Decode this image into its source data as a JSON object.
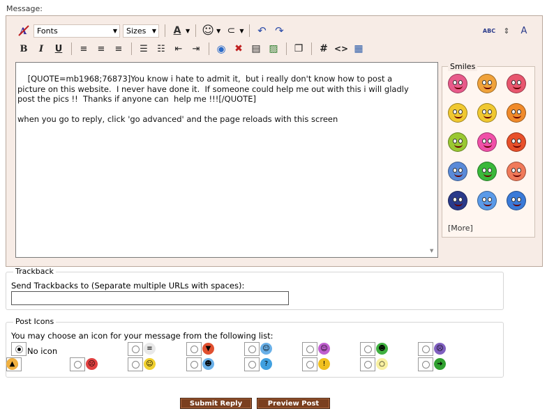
{
  "message_label": "Message:",
  "toolbar": {
    "fonts_label": "Fonts",
    "sizes_label": "Sizes",
    "font_color_glyph": "A",
    "bold": "B",
    "italic": "I",
    "underline": "U",
    "hash": "#",
    "code": "<>",
    "spell": "ABC",
    "text_size_label": "A"
  },
  "editor": {
    "text": "[QUOTE=mb1968;76873]You know i hate to admit it,  but i really don't know how to post a\npicture on this website.  I never have done it.  If someone could help me out with this i will gladly\npost the pics !!  Thanks if anyone can  help me !!![/QUOTE]\n\nwhen you go to reply, click 'go advanced' and the page reloads with this screen"
  },
  "smiles": {
    "title": "Smiles",
    "more_label": "[More]",
    "colors": [
      "#e85a8a",
      "#f0a23a",
      "#e8566e",
      "#f0c830",
      "#f0c830",
      "#f08a2a",
      "#9ac832",
      "#f050a8",
      "#e8502a",
      "#5a8ad8",
      "#3ab83a",
      "#f07a5a",
      "#2a3a8a",
      "#5a9ae8",
      "#3a7ad8"
    ]
  },
  "trackback": {
    "legend": "Trackback",
    "prompt": "Send Trackbacks to (Separate multiple URLs with spaces):",
    "value": ""
  },
  "post_icons": {
    "legend": "Post Icons",
    "prompt": "You may choose an icon for your message from the following list:",
    "no_icon_label": "No icon",
    "icons": [
      {
        "name": "document-icon",
        "color": "#e8e8e8",
        "glyph": "≡"
      },
      {
        "name": "thumbs-down-icon",
        "color": "#e05030",
        "glyph": "▼"
      },
      {
        "name": "smile-icon",
        "color": "#6ab0e8",
        "glyph": "☺"
      },
      {
        "name": "tongue-icon",
        "color": "#c060d0",
        "glyph": "☺"
      },
      {
        "name": "grin-icon",
        "color": "#40b040",
        "glyph": "☻"
      },
      {
        "name": "sad-icon",
        "color": "#8060c0",
        "glyph": "☹"
      },
      {
        "name": "angry-icon",
        "color": "#e04040",
        "glyph": "☹"
      },
      {
        "name": "happy-icon",
        "color": "#f0d030",
        "glyph": "☺"
      },
      {
        "name": "cool-icon",
        "color": "#6ab0e8",
        "glyph": "☻"
      },
      {
        "name": "question-icon",
        "color": "#40a0e0",
        "glyph": "?"
      },
      {
        "name": "warning-icon",
        "color": "#f0c020",
        "glyph": "!"
      },
      {
        "name": "lightbulb-icon",
        "color": "#f8f0a0",
        "glyph": "○"
      },
      {
        "name": "arrow-icon",
        "color": "#30a030",
        "glyph": "➜"
      },
      {
        "name": "thumbs-up-icon",
        "color": "#f0b040",
        "glyph": "▲"
      }
    ]
  },
  "buttons": {
    "submit": "Submit Reply",
    "preview": "Preview Post"
  }
}
